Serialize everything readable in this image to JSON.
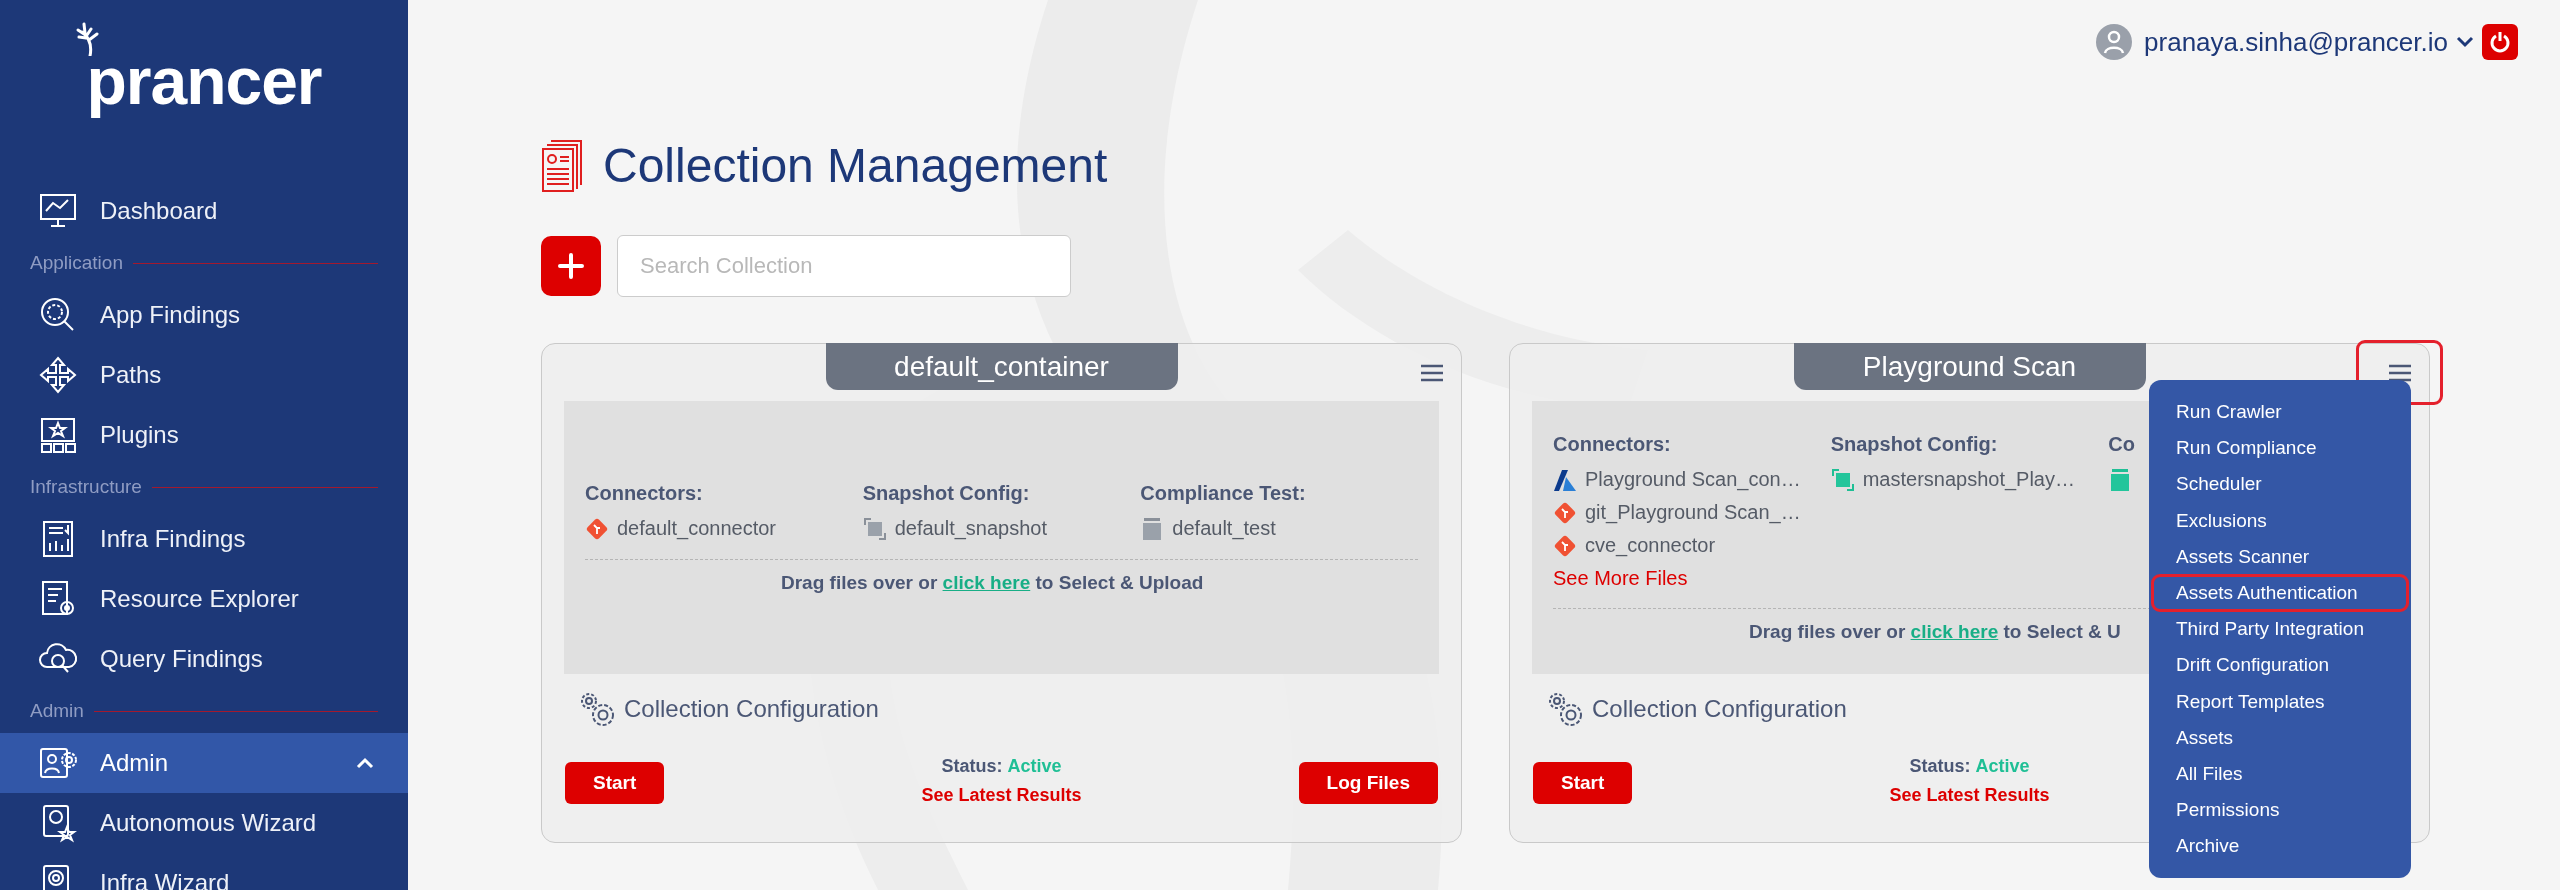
{
  "sidebar": {
    "logo": "prancer",
    "items": [
      {
        "kind": "link",
        "label": "Dashboard",
        "selected": false
      },
      {
        "kind": "section",
        "label": "Application"
      },
      {
        "kind": "link",
        "label": "App Findings",
        "selected": false
      },
      {
        "kind": "link",
        "label": "Paths",
        "selected": false
      },
      {
        "kind": "link",
        "label": "Plugins",
        "selected": false
      },
      {
        "kind": "section",
        "label": "Infrastructure"
      },
      {
        "kind": "link",
        "label": "Infra Findings",
        "selected": false
      },
      {
        "kind": "link",
        "label": "Resource Explorer",
        "selected": false
      },
      {
        "kind": "link",
        "label": "Query Findings",
        "selected": false
      },
      {
        "kind": "section",
        "label": "Admin"
      },
      {
        "kind": "link",
        "label": "Admin",
        "selected": true,
        "expanded": true
      },
      {
        "kind": "link",
        "label": "Autonomous Wizard",
        "selected": false
      },
      {
        "kind": "link",
        "label": "Infra Wizard",
        "selected": false
      }
    ]
  },
  "header": {
    "user": "pranaya.sinha@prancer.io"
  },
  "page": {
    "title": "Collection Management",
    "search": {
      "placeholder": "Search Collection"
    }
  },
  "collections": [
    {
      "name": "default_container",
      "menu_outlined": false,
      "columns": [
        {
          "heading": "Connectors:",
          "files": [
            {
              "kind": "git",
              "name": "default_connector"
            }
          ]
        },
        {
          "heading": "Snapshot Config:",
          "files": [
            {
              "kind": "snapshot",
              "name": "default_snapshot"
            }
          ]
        },
        {
          "heading": "Compliance Test:",
          "files": [
            {
              "kind": "test",
              "name": "default_test"
            }
          ]
        }
      ],
      "drop_text": {
        "before": "Drag files over or",
        "link": "click here",
        "after": "to Select & Upload"
      },
      "config_label": "Collection Configuration",
      "start_label": "Start",
      "status_label": "Status:",
      "status": "Active",
      "results_link": "See Latest Results",
      "log_button": "Log Files"
    },
    {
      "name": "Playground Scan",
      "menu_outlined": true,
      "columns": [
        {
          "heading": "Connectors:",
          "files": [
            {
              "kind": "azure",
              "name": "Playground Scan_con…"
            },
            {
              "kind": "git",
              "name": "git_Playground Scan_…"
            },
            {
              "kind": "git",
              "name": "cve_connector"
            }
          ],
          "more_link": "See More Files"
        },
        {
          "heading": "Snapshot Config:",
          "files": [
            {
              "kind": "master-snapshot",
              "name": "mastersnapshot_Play…"
            }
          ]
        },
        {
          "heading": "Co",
          "files": [
            {
              "kind": "master-test"
            }
          ]
        }
      ],
      "drop_text": {
        "before": "Drag files over or",
        "link": "click here",
        "after": "to Select & U"
      },
      "config_label": "Collection Configuration",
      "start_label": "Start",
      "status_label": "Status:",
      "status": "Active",
      "results_link": "See Latest Results",
      "menu": {
        "items": [
          {
            "label": "Run Crawler",
            "outlined": false
          },
          {
            "label": "Run Compliance",
            "outlined": false
          },
          {
            "label": "Scheduler",
            "outlined": false
          },
          {
            "label": "Exclusions",
            "outlined": false
          },
          {
            "label": "Assets Scanner",
            "outlined": false
          },
          {
            "label": "Assets Authentication",
            "outlined": true
          },
          {
            "label": "Third Party Integration",
            "outlined": false
          },
          {
            "label": "Drift Configuration",
            "outlined": false
          },
          {
            "label": "Report Templates",
            "outlined": false
          },
          {
            "label": "Assets",
            "outlined": false
          },
          {
            "label": "All Files",
            "outlined": false
          },
          {
            "label": "Permissions",
            "outlined": false
          },
          {
            "label": "Archive",
            "outlined": false
          }
        ]
      }
    }
  ]
}
